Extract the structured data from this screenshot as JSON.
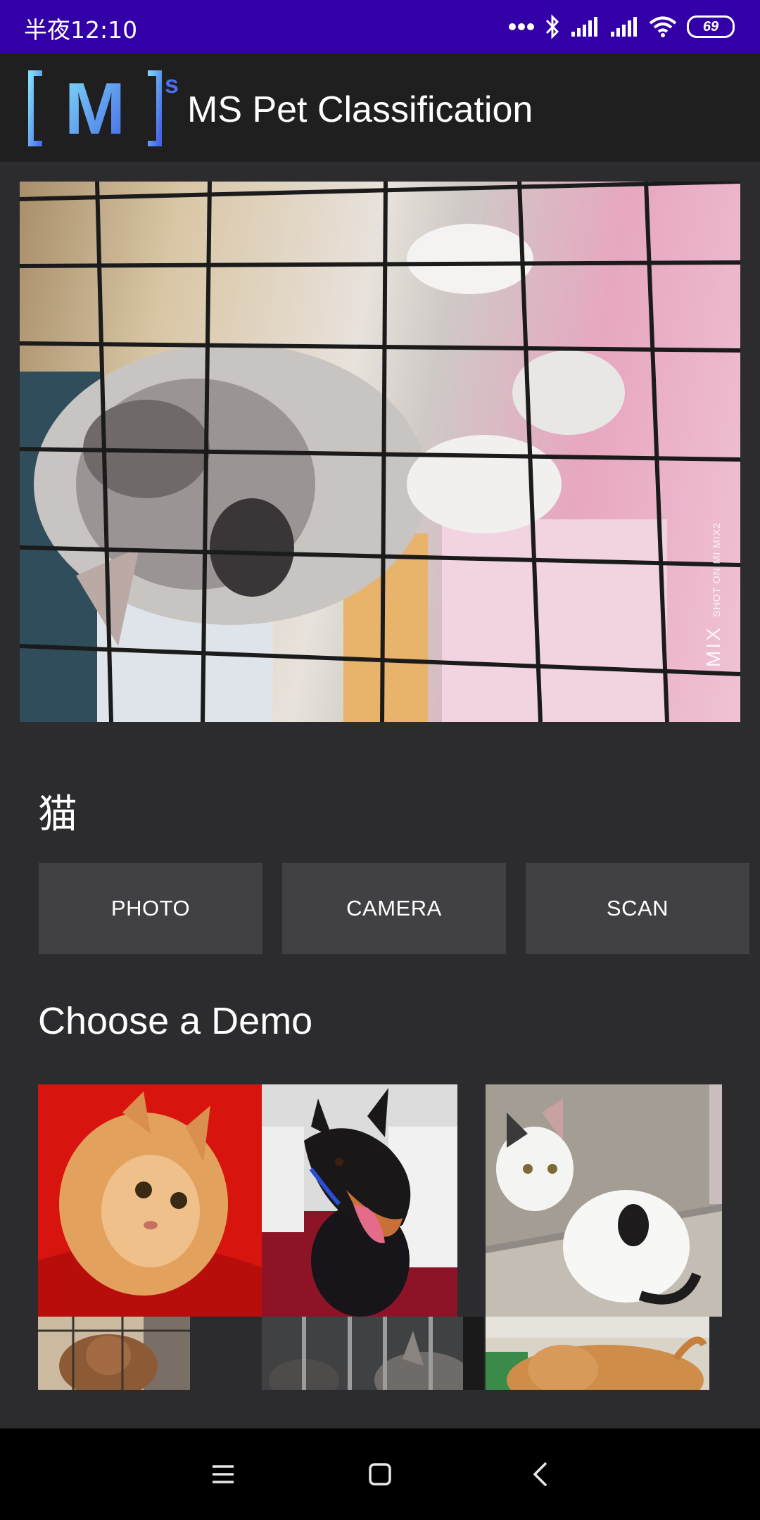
{
  "status_bar": {
    "time": "半夜12:10",
    "battery": "69",
    "icons": [
      "more-dots-icon",
      "bluetooth-icon",
      "signal-icon",
      "signal-icon",
      "wifi-icon",
      "battery-icon"
    ]
  },
  "app_bar": {
    "logo_text": "M",
    "logo_superscript": "s",
    "title": "MS Pet Classification"
  },
  "main_photo": {
    "watermark_brand": "MIX",
    "watermark_caption": "SHOT ON MI MIX2"
  },
  "result": {
    "label": "猫"
  },
  "buttons": {
    "photo": "PHOTO",
    "camera": "CAMERA",
    "scan": "SCAN"
  },
  "demo": {
    "heading": "Choose a Demo",
    "items": [
      {
        "subject": "orange tabby cat"
      },
      {
        "subject": "miniature pinscher dog"
      },
      {
        "subject": "white kitten with black spot"
      },
      {
        "subject": "dog behind cage"
      },
      {
        "subject": "cats behind cage bars"
      },
      {
        "subject": "tan dog lying down"
      }
    ]
  },
  "nav": {
    "icons": [
      "menu-icon",
      "home-square-icon",
      "back-chevron-icon"
    ]
  },
  "colors": {
    "status_bar": "#3300a8",
    "app_bar": "#1f1f1f",
    "background": "#2c2c2e",
    "button": "#414143",
    "logo_gradient_start": "#7fd9f7",
    "logo_gradient_end": "#4a6fe8"
  }
}
